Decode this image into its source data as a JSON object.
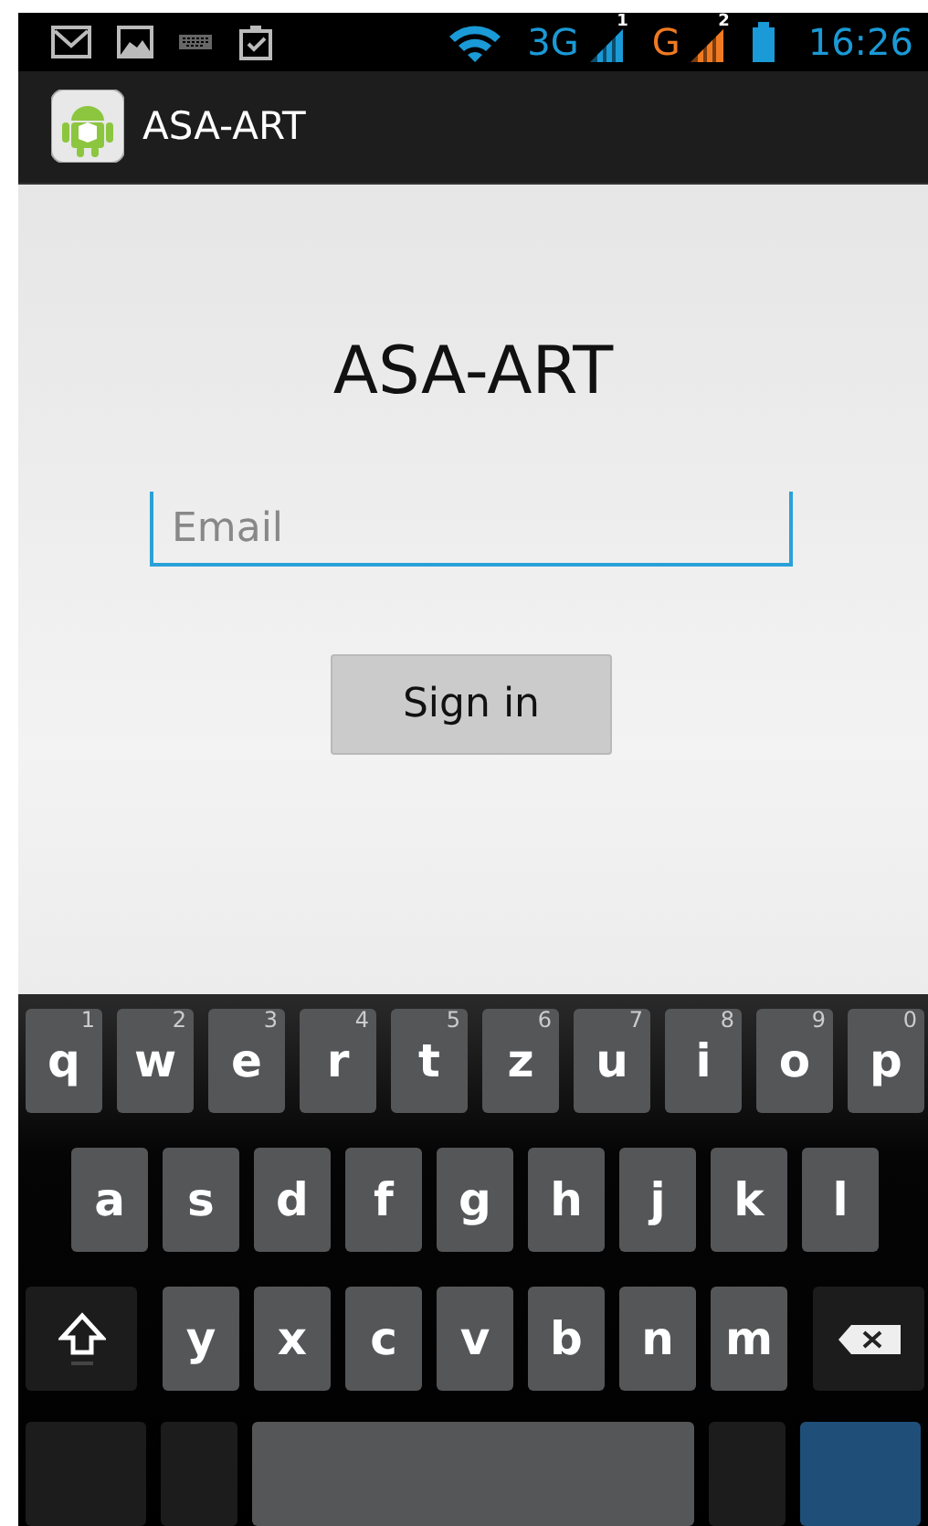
{
  "status_bar": {
    "networks": [
      {
        "type": "3G",
        "sim": "1",
        "color": "#1a9ad6"
      },
      {
        "type": "G",
        "sim": "2",
        "color": "#f07a22"
      }
    ],
    "time": "16:26"
  },
  "app_bar": {
    "title": "ASA-ART"
  },
  "heading": "ASA-ART",
  "email_field": {
    "placeholder": "Email",
    "focused": true
  },
  "sign_in_button": "Sign in",
  "keyboard": {
    "rows": [
      [
        {
          "kind": "letter",
          "label": "q",
          "hint": "1"
        },
        {
          "kind": "letter",
          "label": "w",
          "hint": "2"
        },
        {
          "kind": "letter",
          "label": "e",
          "hint": "3"
        },
        {
          "kind": "letter",
          "label": "r",
          "hint": "4"
        },
        {
          "kind": "letter",
          "label": "t",
          "hint": "5"
        },
        {
          "kind": "letter",
          "label": "z",
          "hint": "6"
        },
        {
          "kind": "letter",
          "label": "u",
          "hint": "7"
        },
        {
          "kind": "letter",
          "label": "i",
          "hint": "8"
        },
        {
          "kind": "letter",
          "label": "o",
          "hint": "9"
        },
        {
          "kind": "letter",
          "label": "p",
          "hint": "0"
        }
      ],
      [
        {
          "kind": "letter",
          "label": "a"
        },
        {
          "kind": "letter",
          "label": "s"
        },
        {
          "kind": "letter",
          "label": "d"
        },
        {
          "kind": "letter",
          "label": "f"
        },
        {
          "kind": "letter",
          "label": "g"
        },
        {
          "kind": "letter",
          "label": "h"
        },
        {
          "kind": "letter",
          "label": "j"
        },
        {
          "kind": "letter",
          "label": "k"
        },
        {
          "kind": "letter",
          "label": "l"
        }
      ],
      [
        {
          "kind": "shift"
        },
        {
          "kind": "letter",
          "label": "y"
        },
        {
          "kind": "letter",
          "label": "x"
        },
        {
          "kind": "letter",
          "label": "c"
        },
        {
          "kind": "letter",
          "label": "v"
        },
        {
          "kind": "letter",
          "label": "b"
        },
        {
          "kind": "letter",
          "label": "n"
        },
        {
          "kind": "letter",
          "label": "m"
        },
        {
          "kind": "backspace"
        }
      ],
      [
        {
          "kind": "function"
        },
        {
          "kind": "function-small"
        },
        {
          "kind": "space"
        },
        {
          "kind": "function-small"
        },
        {
          "kind": "enter"
        }
      ]
    ]
  }
}
